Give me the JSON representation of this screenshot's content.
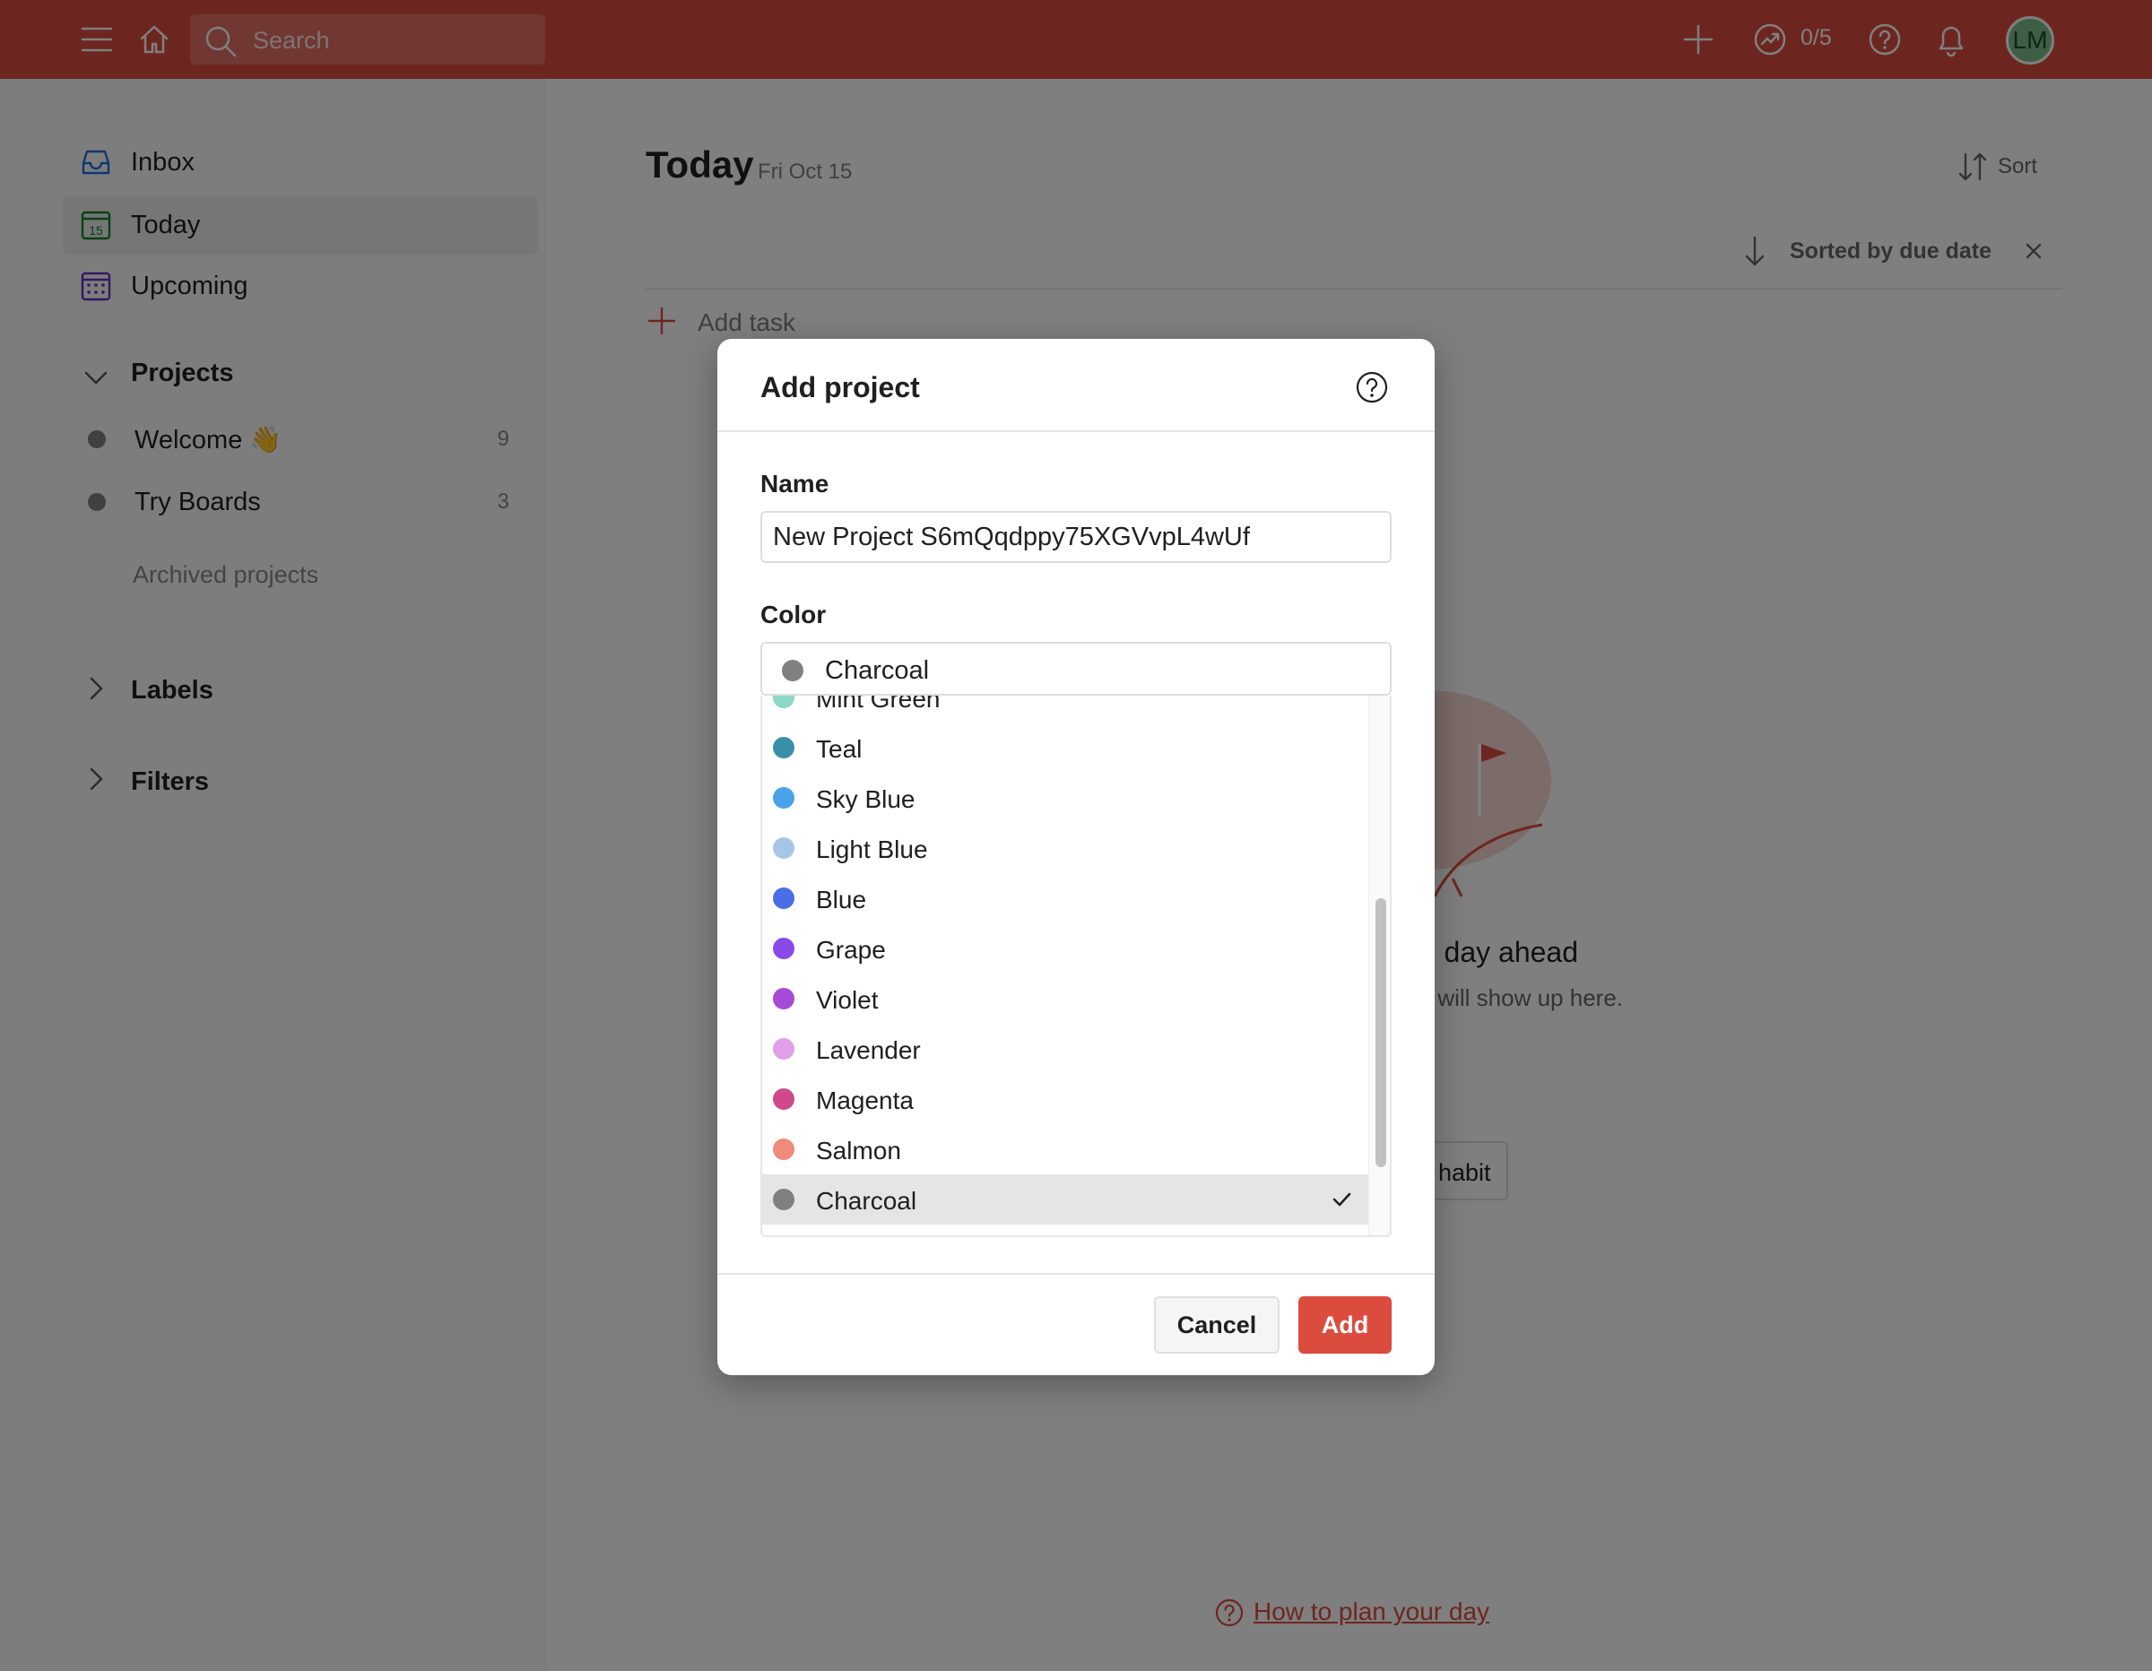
{
  "topbar": {
    "search_placeholder": "Search",
    "karma": "0/5",
    "avatar_initials": "LM",
    "bg_color": "#db4c3f"
  },
  "sidebar": {
    "nav": [
      {
        "label": "Inbox",
        "icon": "inbox-icon"
      },
      {
        "label": "Today",
        "icon": "calendar-today-icon",
        "day": "15",
        "active": true
      },
      {
        "label": "Upcoming",
        "icon": "calendar-grid-icon"
      }
    ],
    "projects_heading": "Projects",
    "projects": [
      {
        "label": "Welcome 👋",
        "count": "9"
      },
      {
        "label": "Try Boards",
        "count": "3"
      }
    ],
    "archived": "Archived projects",
    "labels_heading": "Labels",
    "filters_heading": "Filters"
  },
  "main": {
    "title": "Today",
    "date": "Fri Oct 15",
    "sort_label": "Sort",
    "sorted_by": "Sorted by due date",
    "add_task": "Add task",
    "empty_title": "day ahead",
    "empty_sub": "will show up here.",
    "habit_button": "habit",
    "help_link": "How to plan your day"
  },
  "modal": {
    "title": "Add project",
    "name_label": "Name",
    "name_value": "New Project S6mQqdppy75XGVvpL4wUf",
    "color_label": "Color",
    "color_value": "Charcoal",
    "color_options": [
      {
        "name": "Mint Green",
        "color": "#8cd8c4"
      },
      {
        "name": "Teal",
        "color": "#3a8fa8"
      },
      {
        "name": "Sky Blue",
        "color": "#4aa3e8"
      },
      {
        "name": "Light Blue",
        "color": "#a6c6e8"
      },
      {
        "name": "Blue",
        "color": "#4a6ee8"
      },
      {
        "name": "Grape",
        "color": "#8a4ae8"
      },
      {
        "name": "Violet",
        "color": "#a64ad8"
      },
      {
        "name": "Lavender",
        "color": "#e0a0e8"
      },
      {
        "name": "Magenta",
        "color": "#d04a8a"
      },
      {
        "name": "Salmon",
        "color": "#f08a7a"
      },
      {
        "name": "Charcoal",
        "color": "#808080",
        "selected": true
      }
    ],
    "cancel": "Cancel",
    "add": "Add"
  }
}
